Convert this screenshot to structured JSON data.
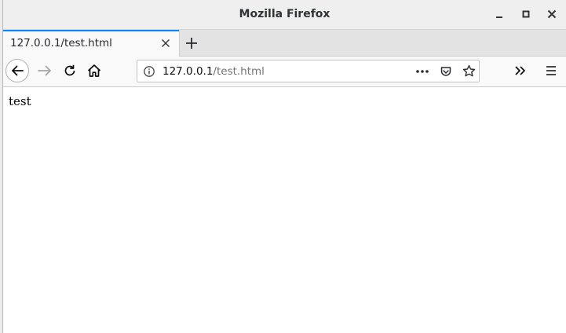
{
  "window": {
    "title": "Mozilla Firefox"
  },
  "tabs": [
    {
      "label": "127.0.0.1/test.html"
    }
  ],
  "urlbar": {
    "host": "127.0.0.1",
    "path": "/test.html"
  },
  "page": {
    "body_text": "test"
  },
  "icons": {
    "minimize": "minimize-icon",
    "maximize": "maximize-icon",
    "close": "close-icon",
    "tab_close": "tab-close-icon",
    "new_tab": "plus-icon",
    "back": "back-arrow-icon",
    "forward": "forward-arrow-icon",
    "reload": "reload-icon",
    "home": "home-icon",
    "site_info": "info-icon",
    "page_actions": "more-horizontal-icon",
    "pocket": "pocket-icon",
    "bookmark": "star-icon",
    "overflow": "chevron-double-right-icon",
    "menu": "hamburger-menu-icon"
  },
  "colors": {
    "tab_accent": "#0a84ff",
    "chrome": "#efefef",
    "toolbar": "#f9f9fa"
  }
}
